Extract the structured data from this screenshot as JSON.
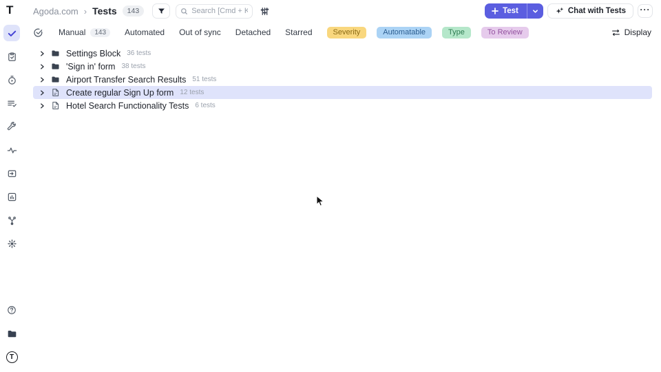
{
  "app": {
    "logo_text": "T",
    "avatar_text": "T"
  },
  "header": {
    "breadcrumb": {
      "project": "Agoda.com",
      "separator": "›",
      "page": "Tests",
      "count": "143"
    },
    "search": {
      "placeholder": "Search [Cmd + K]"
    },
    "actions": {
      "new_test_label": "Test",
      "chat_label": "Chat with Tests",
      "more_label": "···"
    }
  },
  "filter_bar": {
    "items": [
      {
        "label": "Manual",
        "count": "143"
      },
      {
        "label": "Automated"
      },
      {
        "label": "Out of sync"
      },
      {
        "label": "Detached"
      },
      {
        "label": "Starred"
      }
    ],
    "badges": [
      {
        "label": "Severity",
        "style": "background:#f9d77e;color:#8a6a14"
      },
      {
        "label": "Automatable",
        "style": "background:#abd3f5;color:#2b5d90"
      },
      {
        "label": "Type",
        "style": "background:#b5e7ca;color:#2f7d53"
      },
      {
        "label": "To Review",
        "style": "background:#e6cbec;color:#93519f"
      }
    ],
    "display_label": "Display"
  },
  "tree": {
    "rows": [
      {
        "type": "folder",
        "label": "Settings Block",
        "count": "36 tests",
        "selected": false
      },
      {
        "type": "folder",
        "label": "'Sign in' form",
        "count": "38 tests",
        "selected": false
      },
      {
        "type": "folder",
        "label": "Airport Transfer Search Results",
        "count": "51 tests",
        "selected": false
      },
      {
        "type": "doc",
        "label": "Create regular Sign Up form",
        "count": "12 tests",
        "selected": true
      },
      {
        "type": "doc",
        "label": "Hotel Search Functionality Tests",
        "count": "6 tests",
        "selected": false
      }
    ]
  },
  "icons": {
    "sidebar": [
      "check-icon",
      "clipboard-check-icon",
      "timer-play-icon",
      "list-check-icon",
      "wrench-icon",
      "pulse-icon",
      "import-box-icon",
      "chart-square-icon",
      "branch-icon",
      "gear-icon",
      "help-icon",
      "folder-icon",
      "avatar"
    ],
    "colors": {
      "accent": "#5b5ee0",
      "selected_row": "#dfe3fb",
      "active_rail": "#dfe3fa"
    }
  }
}
